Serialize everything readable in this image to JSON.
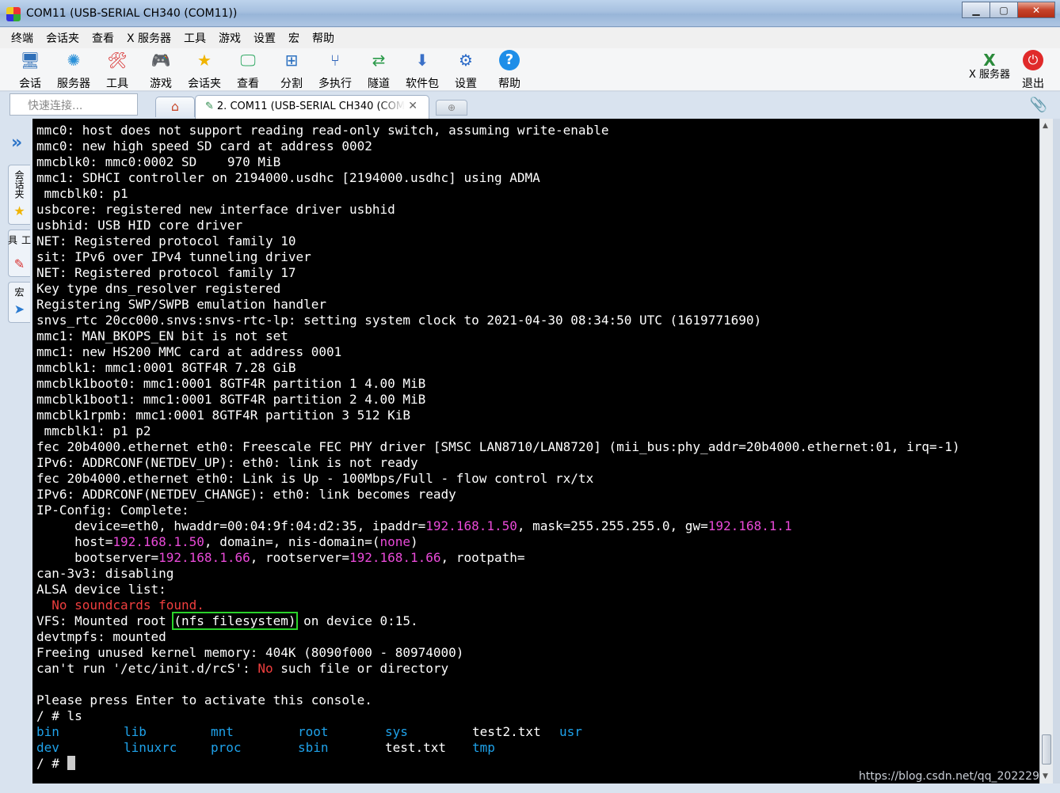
{
  "window": {
    "title": "COM11  (USB-SERIAL CH340 (COM11))"
  },
  "menu": [
    "终端",
    "会话夹",
    "查看",
    "X 服务器",
    "工具",
    "游戏",
    "设置",
    "宏",
    "帮助"
  ],
  "toolbar": {
    "session": "会话",
    "servers": "服务器",
    "tools": "工具",
    "games": "游戏",
    "folder": "会话夹",
    "view": "查看",
    "split": "分割",
    "multiexec": "多执行",
    "tunnel": "隧道",
    "packages": "软件包",
    "settings": "设置",
    "help": "帮助",
    "xserver": "X 服务器",
    "exit": "退出"
  },
  "quick_connect": {
    "placeholder": "快速连接..."
  },
  "tab": {
    "label": "2. COM11  (USB-SERIAL CH340 (COM"
  },
  "sidebar": {
    "sessions": "会话夹",
    "tools": "工具",
    "macros": "宏"
  },
  "terminal": {
    "lines": [
      "mmc0: host does not support reading read-only switch, assuming write-enable",
      "mmc0: new high speed SD card at address 0002",
      "mmcblk0: mmc0:0002 SD    970 MiB",
      "mmc1: SDHCI controller on 2194000.usdhc [2194000.usdhc] using ADMA",
      " mmcblk0: p1",
      "usbcore: registered new interface driver usbhid",
      "usbhid: USB HID core driver",
      "NET: Registered protocol family 10",
      "sit: IPv6 over IPv4 tunneling driver",
      "NET: Registered protocol family 17",
      "Key type dns_resolver registered",
      "Registering SWP/SWPB emulation handler",
      "snvs_rtc 20cc000.snvs:snvs-rtc-lp: setting system clock to 2021-04-30 08:34:50 UTC (1619771690)",
      "mmc1: MAN_BKOPS_EN bit is not set",
      "mmc1: new HS200 MMC card at address 0001",
      "mmcblk1: mmc1:0001 8GTF4R 7.28 GiB",
      "mmcblk1boot0: mmc1:0001 8GTF4R partition 1 4.00 MiB",
      "mmcblk1boot1: mmc1:0001 8GTF4R partition 2 4.00 MiB",
      "mmcblk1rpmb: mmc1:0001 8GTF4R partition 3 512 KiB",
      " mmcblk1: p1 p2",
      "fec 20b4000.ethernet eth0: Freescale FEC PHY driver [SMSC LAN8710/LAN8720] (mii_bus:phy_addr=20b4000.ethernet:01, irq=-1)",
      "IPv6: ADDRCONF(NETDEV_UP): eth0: link is not ready",
      "fec 20b4000.ethernet eth0: Link is Up - 100Mbps/Full - flow control rx/tx",
      "IPv6: ADDRCONF(NETDEV_CHANGE): eth0: link becomes ready",
      "IP-Config: Complete:"
    ],
    "ipconfig": {
      "l1_a": "     device=eth0, hwaddr=00:04:9f:04:d2:35, ipaddr=",
      "l1_ip": "192.168.1.50",
      "l1_b": ", mask=255.255.255.0, gw=",
      "l1_gw": "192.168.1.1",
      "l2_a": "     host=",
      "l2_ip": "192.168.1.50",
      "l2_b": ", domain=, nis-domain=(",
      "l2_none": "none",
      "l2_c": ")",
      "l3_a": "     bootserver=",
      "l3_ip": "192.168.1.66",
      "l3_b": ", rootserver=",
      "l3_ip2": "192.168.1.66",
      "l3_c": ", rootpath="
    },
    "after": [
      "can-3v3: disabling",
      "ALSA device list:"
    ],
    "no_sound": "  No soundcards found.",
    "vfs_a": "VFS: Mounted root ",
    "vfs_hl": "(nfs filesystem)",
    "vfs_b": " on device 0:15.",
    "after2": [
      "devtmpfs: mounted",
      "Freeing unused kernel memory: 404K (8090f000 - 80974000)"
    ],
    "cant_a": "can't run '/etc/init.d/rcS': ",
    "cant_no": "No",
    "cant_b": " such file or directory",
    "blank": "",
    "press": "Please press Enter to activate this console.",
    "ls_cmd": "/ # ls",
    "ls_row1": [
      {
        "name": "bin",
        "dir": true
      },
      {
        "name": "lib",
        "dir": true
      },
      {
        "name": "mnt",
        "dir": true
      },
      {
        "name": "root",
        "dir": true
      },
      {
        "name": "sys",
        "dir": true
      },
      {
        "name": "test2.txt",
        "dir": false
      },
      {
        "name": "usr",
        "dir": true
      }
    ],
    "ls_row2": [
      {
        "name": "dev",
        "dir": true
      },
      {
        "name": "linuxrc",
        "dir": true
      },
      {
        "name": "proc",
        "dir": true
      },
      {
        "name": "sbin",
        "dir": true
      },
      {
        "name": "test.txt",
        "dir": false
      },
      {
        "name": "tmp",
        "dir": true
      }
    ],
    "prompt": "/ # "
  },
  "watermark": "https://blog.csdn.net/qq_202229",
  "colors": {
    "ip": "#e94ad8",
    "error": "#ef3e3e",
    "dir": "#1fa2ea",
    "highlight": "#2ad32a"
  }
}
